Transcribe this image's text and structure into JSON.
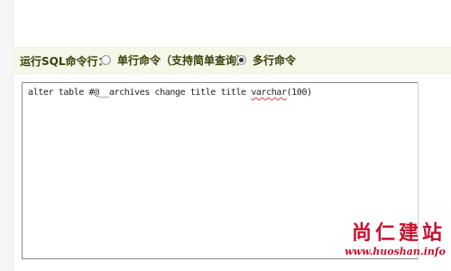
{
  "mode_bar": {
    "label": "运行SQL命令行：",
    "options": [
      {
        "label": "单行命令（支持简单查询）",
        "selected": false
      },
      {
        "label": "多行命令",
        "selected": true
      }
    ]
  },
  "sql_input": {
    "before": "alter table #@__archives change title title ",
    "misspelled": "varchar",
    "after": "(100)"
  },
  "watermark": {
    "logo_text": "尚仁建站",
    "url": "www.huoshan.info"
  },
  "colors": {
    "label_text": "#3a3f0a",
    "mode_bar_bg": "#f6f7e9",
    "watermark_red": "#c8102e"
  }
}
